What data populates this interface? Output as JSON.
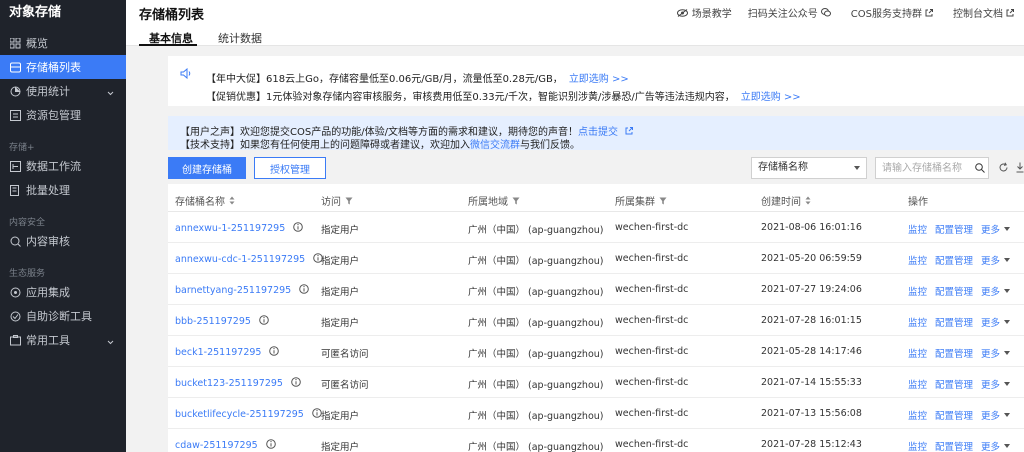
{
  "sidebar": {
    "title": "对象存储",
    "items": [
      {
        "label": "概览",
        "icon": "grid-icon"
      },
      {
        "label": "存储桶列表",
        "icon": "bucket-icon",
        "active": true
      },
      {
        "label": "使用统计",
        "icon": "pie-icon"
      },
      {
        "label": "资源包管理",
        "icon": "package-icon"
      },
      {
        "label": "数据工作流",
        "icon": "workflow-icon"
      },
      {
        "label": "批量处理",
        "icon": "batch-icon"
      },
      {
        "label": "内容审核",
        "icon": "audit-icon"
      },
      {
        "label": "应用集成",
        "icon": "integration-icon"
      },
      {
        "label": "自助诊断工具",
        "icon": "diagnose-icon"
      },
      {
        "label": "常用工具",
        "icon": "tools-icon"
      }
    ],
    "groups": [
      "存储+",
      "内容安全",
      "生态服务"
    ]
  },
  "header": {
    "title": "存储桶列表",
    "links": [
      "场景教学",
      "扫码关注公众号",
      "COS服务支持群",
      "控制台文档"
    ],
    "tabs": [
      "基本信息",
      "统计数据"
    ]
  },
  "promo": {
    "line1": "【年中大促】618云上Go，存储容量低至0.06元/GB/月，流量低至0.28元/GB，",
    "line1_link": "立即选购 >>",
    "line2": "【促销优惠】1元体验对象存储内容审核服务，审核费用低至0.33元/千次，智能识别涉黄/涉暴恐/广告等违法违规内容，",
    "line2_link": "立即选购 >>"
  },
  "notice": {
    "line1": "【用户之声】欢迎您提交COS产品的功能/体验/文档等方面的需求和建议，期待您的声音！",
    "line1_link": "点击提交",
    "line2_pre": "【技术支持】如果您有任何使用上的问题障碍或者建议，欢迎加入",
    "line2_link": "微信交流群",
    "line2_post": "与我们反馈。"
  },
  "toolbar": {
    "create_label": "创建存储桶",
    "auth_label": "授权管理",
    "select_value": "存储桶名称",
    "search_placeholder": "请输入存储桶名称"
  },
  "table": {
    "headers": [
      "存储桶名称",
      "访问",
      "所属地域",
      "所属集群",
      "创建时间",
      "操作"
    ],
    "op_labels": [
      "监控",
      "配置管理",
      "更多"
    ],
    "rows": [
      {
        "name": "annexwu-1-251197295",
        "access": "指定用户",
        "region": "广州（中国）  (ap-guangzhou)",
        "cluster": "wechen-first-dc",
        "time": "2021-08-06 16:01:16"
      },
      {
        "name": "annexwu-cdc-1-251197295",
        "access": "指定用户",
        "region": "广州（中国）  (ap-guangzhou)",
        "cluster": "wechen-first-dc",
        "time": "2021-05-20 06:59:59"
      },
      {
        "name": "barnettyang-251197295",
        "access": "指定用户",
        "region": "广州（中国）  (ap-guangzhou)",
        "cluster": "wechen-first-dc",
        "time": "2021-07-27 19:24:06"
      },
      {
        "name": "bbb-251197295",
        "access": "指定用户",
        "region": "广州（中国）  (ap-guangzhou)",
        "cluster": "wechen-first-dc",
        "time": "2021-07-28 16:01:15"
      },
      {
        "name": "beck1-251197295",
        "access": "可匿名访问",
        "region": "广州（中国）  (ap-guangzhou)",
        "cluster": "wechen-first-dc",
        "time": "2021-05-28 14:17:46"
      },
      {
        "name": "bucket123-251197295",
        "access": "可匿名访问",
        "region": "广州（中国）  (ap-guangzhou)",
        "cluster": "wechen-first-dc",
        "time": "2021-07-14 15:55:33"
      },
      {
        "name": "bucketlifecycle-251197295",
        "access": "指定用户",
        "region": "广州（中国）  (ap-guangzhou)",
        "cluster": "wechen-first-dc",
        "time": "2021-07-13 15:56:08"
      },
      {
        "name": "cdaw-251197295",
        "access": "指定用户",
        "region": "广州（中国）  (ap-guangzhou)",
        "cluster": "wechen-first-dc",
        "time": "2021-07-28 15:12:43"
      }
    ]
  },
  "colors": {
    "accent": "#3b7bf6",
    "sidebar_bg": "#1f232b",
    "notice_bg": "#e5efff"
  }
}
